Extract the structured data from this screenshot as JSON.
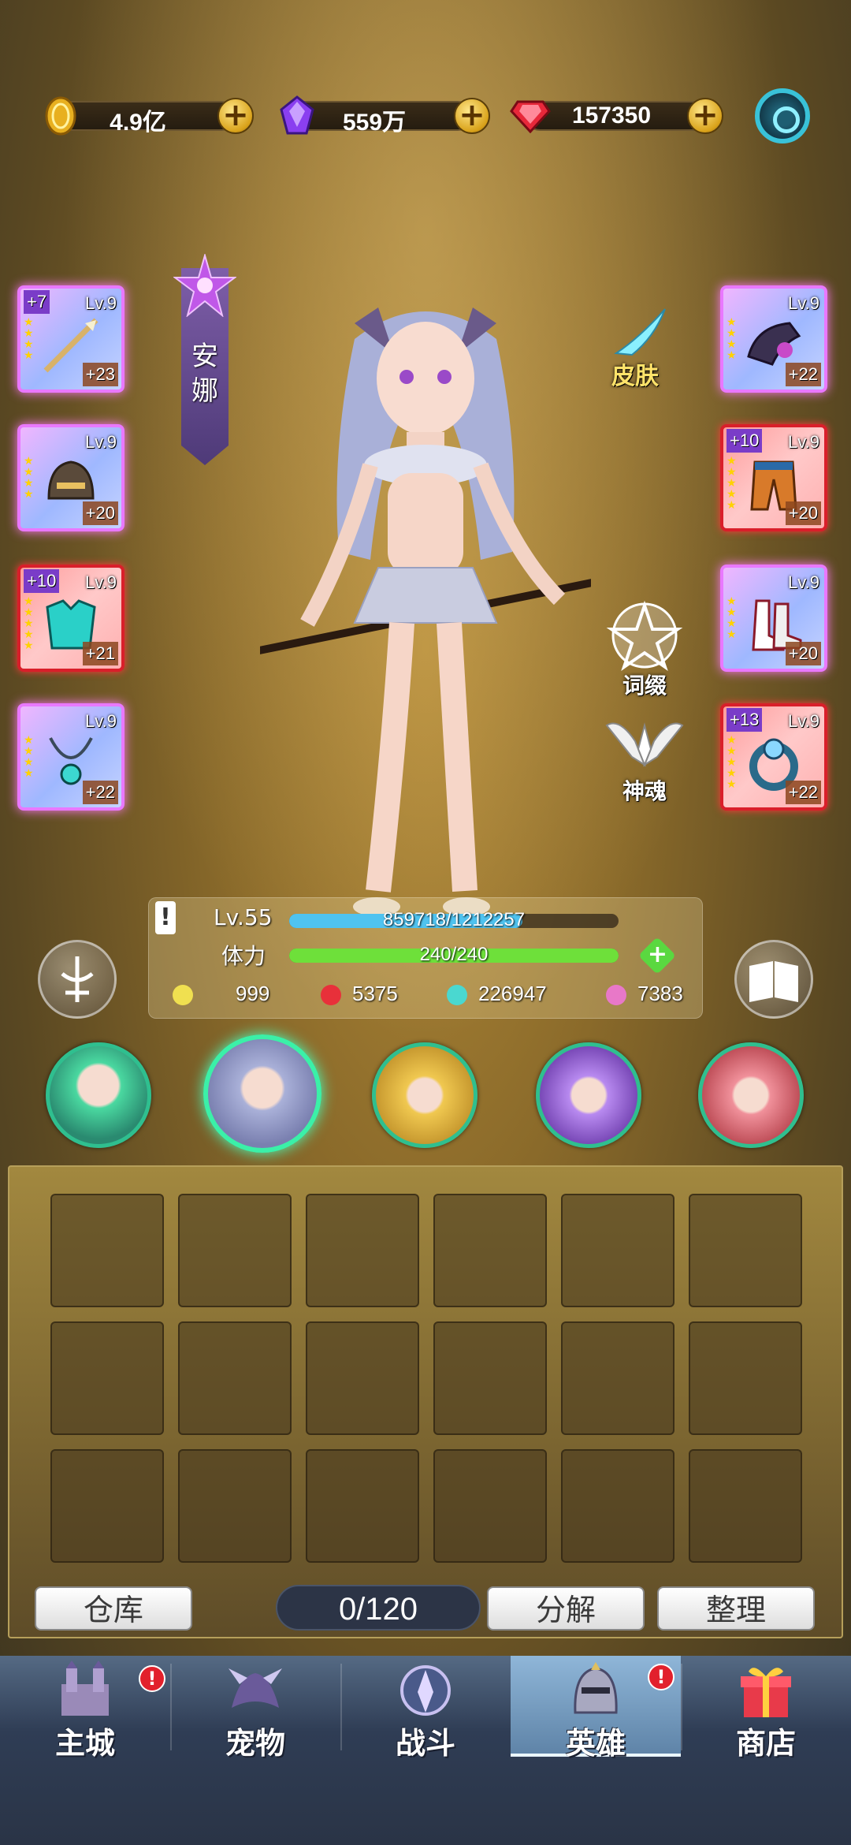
{
  "currencies": [
    {
      "name": "gold",
      "value": "4.9亿",
      "icon": "gold-coin-icon"
    },
    {
      "name": "crystal",
      "value": "559万",
      "icon": "purple-crystal-icon"
    },
    {
      "name": "ruby",
      "value": "157350",
      "icon": "red-gem-icon"
    }
  ],
  "hero": {
    "name": "安娜",
    "level": "Lv.55",
    "exp_text": "859718/1212257",
    "exp_progress": 0.709,
    "stamina_label": "体力",
    "stamina_text": "240/240",
    "stamina_progress": 1.0,
    "stats": [
      "999",
      "5375",
      "226947",
      "7383"
    ]
  },
  "side_buttons": {
    "skin": "皮肤",
    "affix": "词缀",
    "soul": "神魂"
  },
  "left_equipment": [
    {
      "level": "Lv.9",
      "plus": "+7",
      "enhance": "+23",
      "rarity": "purple"
    },
    {
      "level": "Lv.9",
      "plus": "",
      "enhance": "+20",
      "rarity": "purple"
    },
    {
      "level": "Lv.9",
      "plus": "+10",
      "enhance": "+21",
      "rarity": "red"
    },
    {
      "level": "Lv.9",
      "plus": "",
      "enhance": "+22",
      "rarity": "purple"
    }
  ],
  "right_equipment": [
    {
      "level": "Lv.9",
      "plus": "",
      "enhance": "+22",
      "rarity": "purple"
    },
    {
      "level": "Lv.9",
      "plus": "+10",
      "enhance": "+20",
      "rarity": "red"
    },
    {
      "level": "Lv.9",
      "plus": "",
      "enhance": "+20",
      "rarity": "purple"
    },
    {
      "level": "Lv.9",
      "plus": "+13",
      "enhance": "+22",
      "rarity": "red"
    }
  ],
  "inventory": {
    "warehouse_label": "仓库",
    "capacity": "0/120",
    "decompose_label": "分解",
    "sort_label": "整理"
  },
  "nav": [
    {
      "label": "主城",
      "badge": "!"
    },
    {
      "label": "宠物",
      "badge": ""
    },
    {
      "label": "战斗",
      "badge": ""
    },
    {
      "label": "英雄",
      "badge": "!"
    },
    {
      "label": "商店",
      "badge": ""
    }
  ],
  "colors": {
    "exp_bar": "#4fc3f0",
    "stamina_bar": "#6ee03a",
    "active_portrait": "#3bf0a8",
    "badge": "#e2202c"
  }
}
